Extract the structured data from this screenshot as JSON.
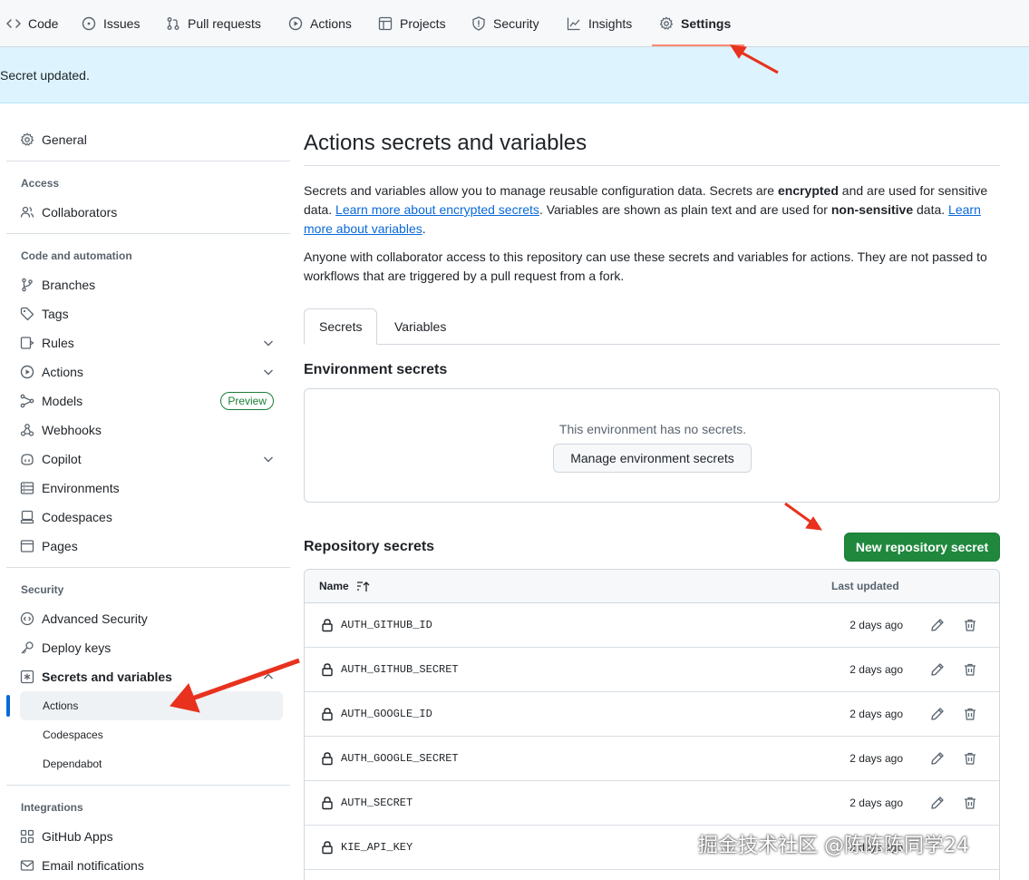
{
  "topnav": {
    "items": [
      {
        "label": "Code",
        "icon": "code-icon"
      },
      {
        "label": "Issues",
        "icon": "issue-icon"
      },
      {
        "label": "Pull requests",
        "icon": "pull-request-icon"
      },
      {
        "label": "Actions",
        "icon": "play-icon"
      },
      {
        "label": "Projects",
        "icon": "table-icon"
      },
      {
        "label": "Security",
        "icon": "shield-icon"
      },
      {
        "label": "Insights",
        "icon": "graph-icon"
      },
      {
        "label": "Settings",
        "icon": "gear-icon",
        "active": true
      }
    ]
  },
  "flash": {
    "message": "Secret updated."
  },
  "sidebar": {
    "general": "General",
    "access_heading": "Access",
    "collaborators": "Collaborators",
    "code_heading": "Code and automation",
    "branches": "Branches",
    "tags": "Tags",
    "rules": "Rules",
    "actions": "Actions",
    "models": "Models",
    "models_badge": "Preview",
    "webhooks": "Webhooks",
    "copilot": "Copilot",
    "environments": "Environments",
    "codespaces": "Codespaces",
    "pages": "Pages",
    "security_heading": "Security",
    "advanced_security": "Advanced Security",
    "deploy_keys": "Deploy keys",
    "secrets_vars": "Secrets and variables",
    "sub_actions": "Actions",
    "sub_codespaces": "Codespaces",
    "sub_dependabot": "Dependabot",
    "integrations_heading": "Integrations",
    "github_apps": "GitHub Apps",
    "email_notifications": "Email notifications"
  },
  "main": {
    "title": "Actions secrets and variables",
    "p1_a": "Secrets and variables allow you to manage reusable configuration data. Secrets are ",
    "p1_b": "encrypted",
    "p1_c": " and are used for sensitive data. ",
    "p1_link1": "Learn more about encrypted secrets",
    "p1_d": ". Variables are shown as plain text and are used for ",
    "p1_e": "non-sensitive",
    "p1_f": " data. ",
    "p1_link2": "Learn more about variables",
    "p1_g": ".",
    "p2": "Anyone with collaborator access to this repository can use these secrets and variables for actions. They are not passed to workflows that are triggered by a pull request from a fork.",
    "tab_secrets": "Secrets",
    "tab_variables": "Variables",
    "env_heading": "Environment secrets",
    "env_empty": "This environment has no secrets.",
    "env_button": "Manage environment secrets",
    "repo_heading": "Repository secrets",
    "new_secret_button": "New repository secret",
    "col_name": "Name",
    "col_updated": "Last updated",
    "secrets": [
      {
        "name": "AUTH_GITHUB_ID",
        "updated": "2 days ago"
      },
      {
        "name": "AUTH_GITHUB_SECRET",
        "updated": "2 days ago"
      },
      {
        "name": "AUTH_GOOGLE_ID",
        "updated": "2 days ago"
      },
      {
        "name": "AUTH_GOOGLE_SECRET",
        "updated": "2 days ago"
      },
      {
        "name": "AUTH_SECRET",
        "updated": "2 days ago"
      },
      {
        "name": "KIE_API_KEY",
        "updated": "2 days ago"
      }
    ]
  },
  "watermark": "掘金技术社区 @陈陈陈同学24",
  "colors": {
    "accent": "#0969da",
    "primary_button": "#1f883d",
    "annotation_arrow": "#e8321e"
  }
}
